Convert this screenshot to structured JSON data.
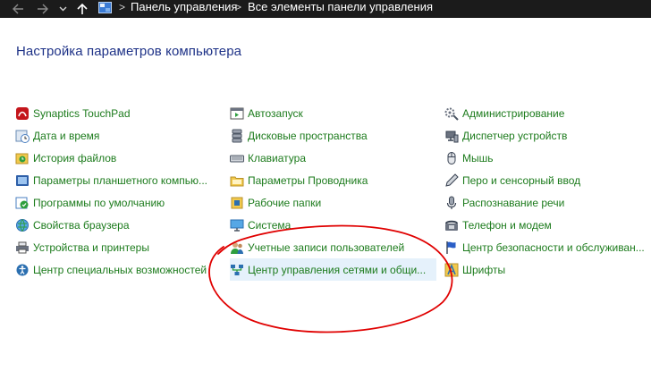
{
  "addressbar": {
    "crumbs": [
      "Панель управления",
      "Все элементы панели управления"
    ],
    "separator": ">"
  },
  "page_title": "Настройка параметров компьютера",
  "columns": [
    [
      {
        "label": "Synaptics TouchPad",
        "icon": "touchpad-icon"
      },
      {
        "label": "Дата и время",
        "icon": "clock-icon"
      },
      {
        "label": "История файлов",
        "icon": "file-history-icon"
      },
      {
        "label": "Параметры планшетного компью...",
        "icon": "tablet-icon"
      },
      {
        "label": "Программы по умолчанию",
        "icon": "default-programs-icon"
      },
      {
        "label": "Свойства браузера",
        "icon": "globe-icon"
      },
      {
        "label": "Устройства и принтеры",
        "icon": "printer-icon"
      },
      {
        "label": "Центр специальных возможностей",
        "icon": "accessibility-icon"
      }
    ],
    [
      {
        "label": "Автозапуск",
        "icon": "autoplay-icon"
      },
      {
        "label": "Дисковые пространства",
        "icon": "storage-icon"
      },
      {
        "label": "Клавиатура",
        "icon": "keyboard-icon"
      },
      {
        "label": "Параметры Проводника",
        "icon": "folder-options-icon"
      },
      {
        "label": "Рабочие папки",
        "icon": "work-folders-icon"
      },
      {
        "label": "Система",
        "icon": "system-icon"
      },
      {
        "label": "Учетные записи пользователей",
        "icon": "users-icon"
      },
      {
        "label": "Центр управления сетями и общи...",
        "icon": "network-icon"
      }
    ],
    [
      {
        "label": "Администрирование",
        "icon": "admin-tools-icon"
      },
      {
        "label": "Диспетчер устройств",
        "icon": "device-manager-icon"
      },
      {
        "label": "Мышь",
        "icon": "mouse-icon"
      },
      {
        "label": "Перо и сенсорный ввод",
        "icon": "pen-icon"
      },
      {
        "label": "Распознавание речи",
        "icon": "microphone-icon"
      },
      {
        "label": "Телефон и модем",
        "icon": "phone-icon"
      },
      {
        "label": "Центр безопасности и обслуживан...",
        "icon": "flag-icon"
      },
      {
        "label": "Шрифты",
        "icon": "fonts-icon"
      }
    ]
  ],
  "colors": {
    "link": "#1c7b1c",
    "title": "#1e3287",
    "hover": "#e5f1fb",
    "annotation": "#e00000",
    "addressbar": "#1b1b1b"
  }
}
